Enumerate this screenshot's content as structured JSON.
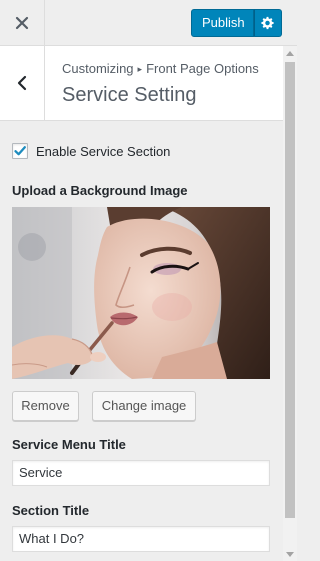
{
  "topbar": {
    "close_icon": "close-icon",
    "publish_label": "Publish",
    "settings_icon": "gear-icon"
  },
  "section": {
    "back_icon": "chevron-left-icon",
    "breadcrumb_root": "Customizing",
    "breadcrumb_separator": "▸",
    "breadcrumb_parent": "Front Page Options",
    "title": "Service Setting"
  },
  "controls": {
    "enable_label": "Enable Service Section",
    "enable_checked": true,
    "background_label": "Upload a Background Image",
    "background_image_description": "woman-makeup-photo",
    "remove_label": "Remove",
    "change_image_label": "Change image",
    "menu_title_label": "Service Menu Title",
    "menu_title_value": "Service",
    "section_title_label": "Section Title",
    "section_title_value": "What I Do?"
  },
  "colors": {
    "accent": "#0085ba",
    "panel_bg": "#eeeeee",
    "checkmark": "#1e8cbe"
  }
}
